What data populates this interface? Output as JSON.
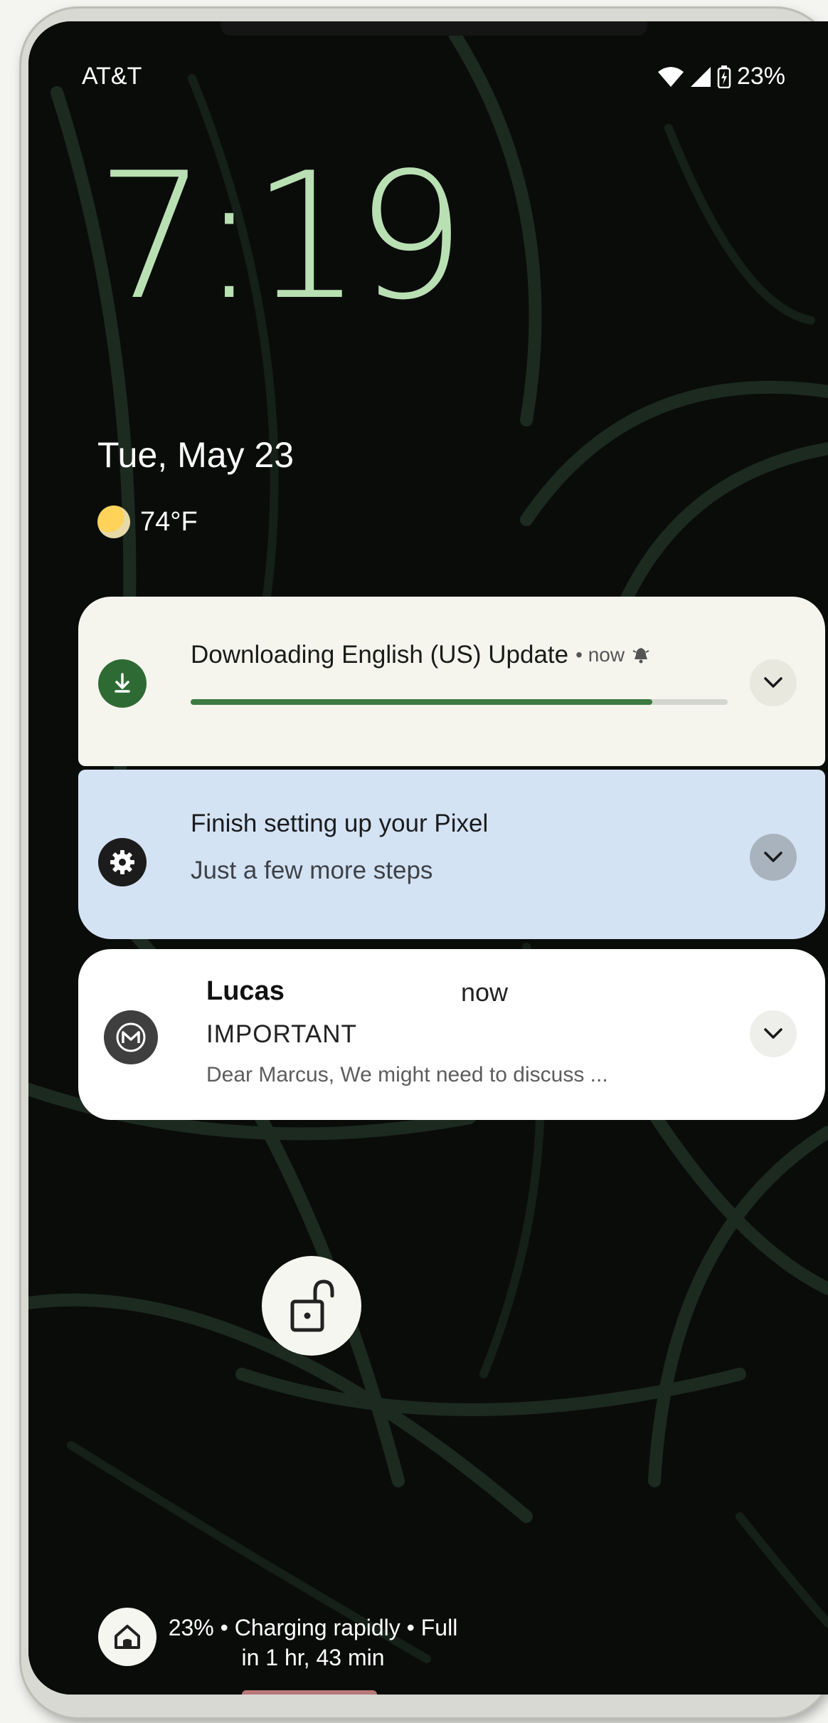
{
  "status_bar": {
    "carrier": "AT&T",
    "battery": "23%",
    "icons": [
      "wifi-icon",
      "signal-icon",
      "battery-charging-icon"
    ]
  },
  "lockscreen": {
    "time": "7:19",
    "date": "Tue, May 23",
    "temperature": "74°F",
    "weather_icon": "partly-sunny-icon"
  },
  "notifications": [
    {
      "title": "Downloading English (US) Update",
      "meta": "• now",
      "progress": 0.86,
      "icon": "download-icon",
      "accent": "#3d7a43"
    },
    {
      "title": "Finish setting up your Pixel",
      "subtitle": "Just a few more steps",
      "icon": "gear-icon"
    },
    {
      "sender": "Lucas",
      "time": "now",
      "subject": "IMPORTANT",
      "preview": "Dear Marcus, We might need to discuss ...",
      "icon": "gmail-icon"
    }
  ],
  "footer": {
    "charging_text": "23% • Charging rapidly • Full in 1 hr, 43 min"
  },
  "colors": {
    "clock": "#b9e0b3",
    "setup_card": "#d4e3f4",
    "download_card": "#f5f5ee"
  }
}
